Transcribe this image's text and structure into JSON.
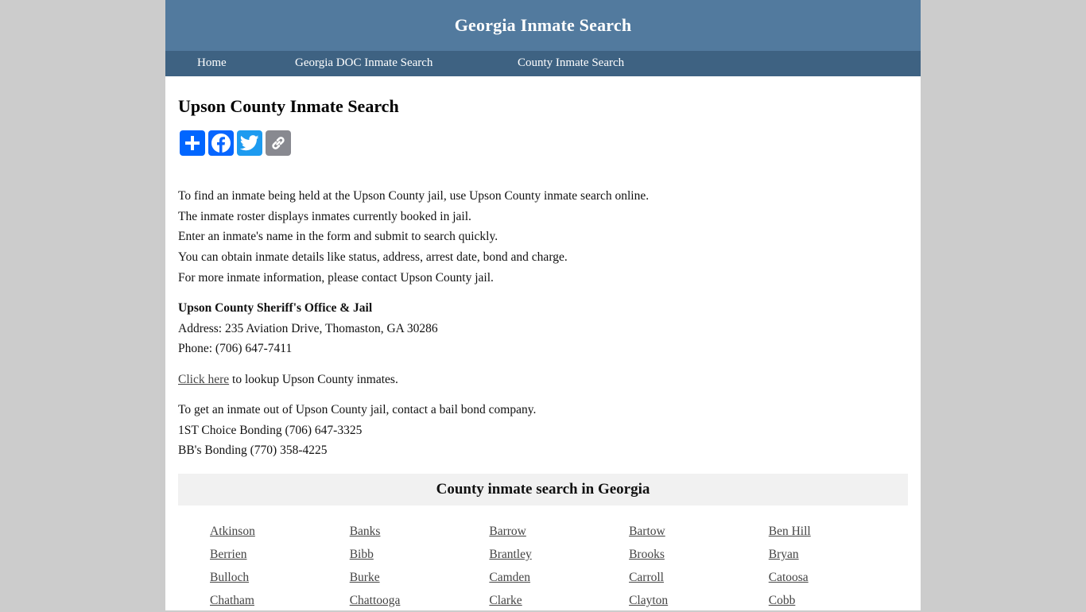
{
  "header": {
    "title": "Georgia Inmate Search"
  },
  "nav": {
    "items": [
      {
        "label": "Home"
      },
      {
        "label": "Georgia DOC Inmate Search"
      },
      {
        "label": "County Inmate Search"
      }
    ]
  },
  "main": {
    "title": "Upson County Inmate Search",
    "share": [
      {
        "icon": "plus-icon",
        "label": "Share",
        "color": "#0166ff"
      },
      {
        "icon": "facebook-icon",
        "label": "Facebook",
        "color": "#0866ff"
      },
      {
        "icon": "twitter-icon",
        "label": "Twitter",
        "color": "#1d9bf0"
      },
      {
        "icon": "link-icon",
        "label": "Copy Link",
        "color": "#888990"
      }
    ],
    "intro": [
      "To find an inmate being held at the Upson County jail, use Upson County inmate search online.",
      "The inmate roster displays inmates currently booked in jail.",
      "Enter an inmate's name in the form and submit to search quickly.",
      "You can obtain inmate details like status, address, arrest date, bond and charge.",
      "For more inmate information, please contact Upson County jail."
    ],
    "office": {
      "name": "Upson County Sheriff's Office & Jail",
      "address": "Address: 235 Aviation Drive, Thomaston, GA 30286",
      "phone": "Phone: (706) 647-7411"
    },
    "lookup": {
      "link_label": "Click here",
      "text": " to lookup Upson County inmates."
    },
    "bail": [
      "To get an inmate out of Upson County jail, contact a bail bond company.",
      "1ST Choice Bonding (706) 647-3325",
      "BB's Bonding (770) 358-4225"
    ]
  },
  "counties": {
    "heading": "County inmate search in Georgia",
    "items": [
      "Atkinson",
      "Banks",
      "Barrow",
      "Bartow",
      "Ben Hill",
      "Berrien",
      "Bibb",
      "Brantley",
      "Brooks",
      "Bryan",
      "Bulloch",
      "Burke",
      "Camden",
      "Carroll",
      "Catoosa",
      "Chatham",
      "Chattooga",
      "Clarke",
      "Clayton",
      "Cobb"
    ]
  }
}
